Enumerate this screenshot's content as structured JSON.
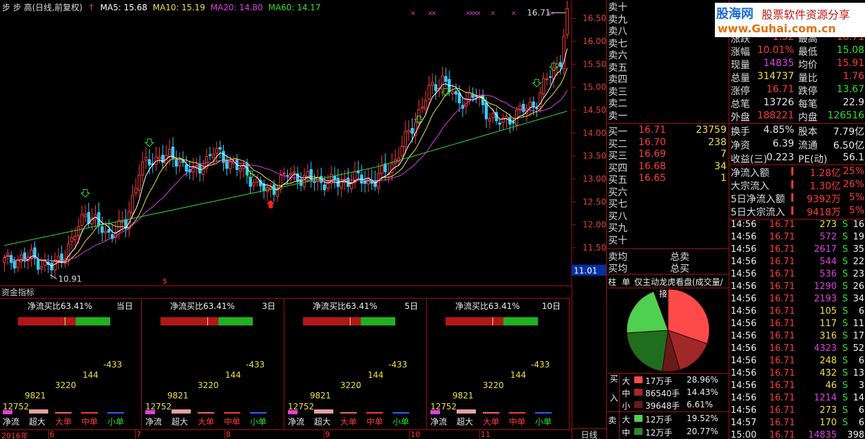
{
  "header": {
    "title": "步 步 高(日线,前复权)",
    "ma": [
      {
        "label": "MA5: 15.68",
        "color": "#ffffff"
      },
      {
        "label": "MA10: 15.19",
        "color": "#f0e040"
      },
      {
        "label": "MA20: 14.80",
        "color": "#e040e0"
      },
      {
        "label": "MA60: 14.17",
        "color": "#30e030"
      }
    ]
  },
  "price_axis": [
    "16.50",
    "16.00",
    "15.50",
    "15.00",
    "14.50",
    "14.00",
    "13.50",
    "13.00",
    "12.50",
    "12.00",
    "11.50",
    "11.00"
  ],
  "current_price_tag": "11.01",
  "hi_label": "16.71",
  "lo_label": "10.91",
  "time_axis": [
    "2016年",
    "6",
    "7",
    "8",
    "9",
    "10",
    "11"
  ],
  "capital": {
    "title": "资金指标",
    "panels": [
      {
        "ratio": "净流买比63.41%",
        "period": "当日"
      },
      {
        "ratio": "净流买比63.41%",
        "period": "3日"
      },
      {
        "ratio": "净流买比63.41%",
        "period": "5日"
      },
      {
        "ratio": "净流买比63.41%",
        "period": "10日"
      }
    ],
    "values": [
      "12752",
      "9821",
      "3220",
      "144",
      "-433"
    ],
    "labels": [
      "净流",
      "超大",
      "大单",
      "中单",
      "小单"
    ]
  },
  "period_button": "日线",
  "orderbook": {
    "sell": [
      {
        "label": "卖十",
        "price": "",
        "vol": ""
      },
      {
        "label": "卖九",
        "price": "",
        "vol": ""
      },
      {
        "label": "卖八",
        "price": "",
        "vol": ""
      },
      {
        "label": "卖七",
        "price": "",
        "vol": ""
      },
      {
        "label": "卖六",
        "price": "",
        "vol": ""
      },
      {
        "label": "卖五",
        "price": "",
        "vol": ""
      },
      {
        "label": "卖四",
        "price": "",
        "vol": ""
      },
      {
        "label": "卖三",
        "price": "",
        "vol": ""
      },
      {
        "label": "卖二",
        "price": "",
        "vol": ""
      },
      {
        "label": "卖一",
        "price": "",
        "vol": ""
      }
    ],
    "buy": [
      {
        "label": "买一",
        "price": "16.71",
        "vol": "23759"
      },
      {
        "label": "买二",
        "price": "16.70",
        "vol": "238"
      },
      {
        "label": "买三",
        "price": "16.69",
        "vol": "7"
      },
      {
        "label": "买四",
        "price": "16.68",
        "vol": "34"
      },
      {
        "label": "买五",
        "price": "16.65",
        "vol": "1"
      },
      {
        "label": "买六",
        "price": "",
        "vol": ""
      },
      {
        "label": "买七",
        "price": "",
        "vol": ""
      },
      {
        "label": "买八",
        "price": "",
        "vol": ""
      },
      {
        "label": "买九",
        "price": "",
        "vol": ""
      },
      {
        "label": "买十",
        "price": "",
        "vol": ""
      }
    ],
    "avg": [
      {
        "label": "卖均",
        "total": "总卖"
      },
      {
        "label": "买均",
        "total": "总买"
      }
    ],
    "tabs": [
      "柱",
      "单",
      "仅主动",
      "龙虎看盘(成交量/接"
    ],
    "flows": {
      "buy_label": "买入",
      "sell_label": "卖",
      "rows": [
        {
          "size": "大",
          "vol": "17万手",
          "pct": "28.96%",
          "color": "#ff4a4a"
        },
        {
          "size": "中",
          "vol": "86540手",
          "pct": "14.43%",
          "color": "#a82828"
        },
        {
          "size": "小",
          "vol": "39648手",
          "pct": "6.61%",
          "color": "#6a1a1a"
        },
        {
          "size": "大",
          "vol": "12万手",
          "pct": "19.52%",
          "color": "#50d050"
        },
        {
          "size": "中",
          "vol": "12万手",
          "pct": "20.77%",
          "color": "#2a8a2a"
        }
      ]
    }
  },
  "brand": {
    "logo": "股海网",
    "tagline": "股票软件资源分享",
    "url": "www.Guhai.com.cn"
  },
  "stats": [
    {
      "k1": "涨跌",
      "v1": "1.52",
      "k2": "最高",
      "v2": "16.71",
      "c1": "#ff3a3a",
      "c2": "#ff3a3a"
    },
    {
      "k1": "涨幅",
      "v1": "10.01%",
      "k2": "最低",
      "v2": "15.08",
      "c1": "#ff3a3a",
      "c2": "#30e030"
    },
    {
      "k1": "现量",
      "v1": "14835",
      "k2": "均价",
      "v2": "15.91",
      "c1": "#e040e0",
      "c2": "#ff3a3a"
    },
    {
      "k1": "总量",
      "v1": "314737",
      "k2": "量比",
      "v2": "1.76",
      "c1": "#f0e040",
      "c2": "#ff3a3a"
    },
    {
      "k1": "涨停",
      "v1": "16.71",
      "k2": "跌停",
      "v2": "13.67",
      "c1": "#ff3a3a",
      "c2": "#30e030"
    },
    {
      "k1": "总笔",
      "v1": "13726",
      "k2": "每笔",
      "v2": "22.9",
      "c1": "#e8e8e8",
      "c2": "#e8e8e8"
    },
    {
      "k1": "外盘",
      "v1": "188221",
      "k2": "内盘",
      "v2": "126516",
      "c1": "#ff3a3a",
      "c2": "#30e030"
    },
    {
      "k1": "换手",
      "v1": "4.85%",
      "k2": "股本",
      "v2": "7.79亿",
      "c1": "#e8e8e8",
      "c2": "#e8e8e8"
    },
    {
      "k1": "净资",
      "v1": "6.39",
      "k2": "流通",
      "v2": "6.50亿",
      "c1": "#e8e8e8",
      "c2": "#e8e8e8"
    },
    {
      "k1": "收益(三)",
      "v1": "0.223",
      "k2": "PE(动)",
      "v2": "56.1",
      "c1": "#e8e8e8",
      "c2": "#e8e8e8"
    }
  ],
  "flow_stats": [
    {
      "k": "净流入额",
      "v": "1.28亿",
      "p": "25%"
    },
    {
      "k": "大宗流入",
      "v": "1.30亿",
      "p": "26%"
    },
    {
      "k": "5日净流入额",
      "v": "9392万",
      "p": "5%"
    },
    {
      "k": "5日大宗流入",
      "v": "9418万",
      "p": "5%"
    }
  ],
  "ticks": [
    {
      "t": "14:56",
      "p": "16.71",
      "v": "273",
      "s": "S",
      "n": "16",
      "vc": "#f0e040"
    },
    {
      "t": "14:56",
      "p": "16.71",
      "v": "572",
      "s": "S",
      "n": "19",
      "vc": "#e040e0"
    },
    {
      "t": "14:56",
      "p": "16.71",
      "v": "2617",
      "s": "S",
      "n": "35",
      "vc": "#e040e0"
    },
    {
      "t": "14:56",
      "p": "16.71",
      "v": "544",
      "s": "S",
      "n": "22",
      "vc": "#e040e0"
    },
    {
      "t": "14:56",
      "p": "16.71",
      "v": "536",
      "s": "S",
      "n": "23",
      "vc": "#e040e0"
    },
    {
      "t": "14:56",
      "p": "16.71",
      "v": "1290",
      "s": "S",
      "n": "26",
      "vc": "#e040e0"
    },
    {
      "t": "14:56",
      "p": "16.71",
      "v": "2193",
      "s": "S",
      "n": "34",
      "vc": "#e040e0"
    },
    {
      "t": "14:56",
      "p": "16.71",
      "v": "105",
      "s": "S",
      "n": "6",
      "vc": "#f0e040"
    },
    {
      "t": "14:56",
      "p": "16.71",
      "v": "117",
      "s": "S",
      "n": "11",
      "vc": "#f0e040"
    },
    {
      "t": "14:56",
      "p": "16.71",
      "v": "316",
      "s": "S",
      "n": "17",
      "vc": "#f0e040"
    },
    {
      "t": "14:56",
      "p": "16.71",
      "v": "4323",
      "s": "S",
      "n": "52",
      "vc": "#e040e0"
    },
    {
      "t": "14:56",
      "p": "16.71",
      "v": "248",
      "s": "S",
      "n": "6",
      "vc": "#f0e040"
    },
    {
      "t": "14:56",
      "p": "16.71",
      "v": "432",
      "s": "S",
      "n": "13",
      "vc": "#f0e040"
    },
    {
      "t": "14:56",
      "p": "16.71",
      "v": "46",
      "s": "S",
      "n": "3",
      "vc": "#f0e040"
    },
    {
      "t": "14:56",
      "p": "16.71",
      "v": "1214",
      "s": "S",
      "n": "14",
      "vc": "#e040e0"
    },
    {
      "t": "14:56",
      "p": "16.71",
      "v": "273",
      "s": "S",
      "n": "6",
      "vc": "#f0e040"
    },
    {
      "t": "14:57",
      "p": "16.71",
      "v": "170",
      "s": "S",
      "n": "6",
      "vc": "#f0e040"
    },
    {
      "t": "15:00",
      "p": "16.71",
      "v": "14835",
      "s": "",
      "n": "398",
      "vc": "#e040e0"
    }
  ]
}
